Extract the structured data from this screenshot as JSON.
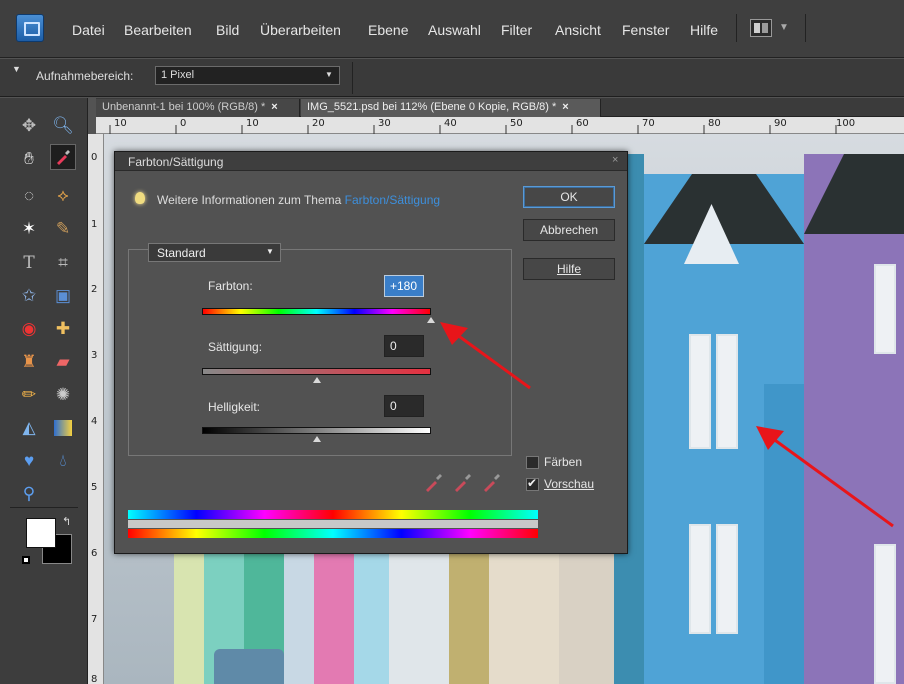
{
  "menu": {
    "items": [
      "Datei",
      "Bearbeiten",
      "Bild",
      "Überarbeiten",
      "Ebene",
      "Auswahl",
      "Filter",
      "Ansicht",
      "Fenster",
      "Hilfe"
    ]
  },
  "options": {
    "label": "Aufnahmebereich:",
    "sample_value": "1 Pixel"
  },
  "tabs": [
    {
      "label": "Unbenannt-1 bei 100% (RGB/8) *",
      "close": "×"
    },
    {
      "label": "IMG_5521.psd bei 112% (Ebene 0 Kopie, RGB/8) *",
      "close": "×"
    }
  ],
  "ruler": {
    "top": [
      "10",
      "0",
      "10",
      "20",
      "30",
      "40",
      "50",
      "60",
      "70",
      "80",
      "90",
      "100"
    ],
    "left": [
      "0",
      "1",
      "2",
      "3",
      "4",
      "5",
      "6",
      "7",
      "8"
    ]
  },
  "dialog": {
    "title": "Farbton/Sättigung",
    "close": "×",
    "info_prefix": "Weitere Informationen zum Thema",
    "info_link": "Farbton/Sättigung",
    "ok": "OK",
    "cancel": "Abbrechen",
    "help": "Hilfe",
    "channel": "Standard",
    "hue_label": "Farbton:",
    "hue_value": "+180",
    "saturation_label": "Sättigung:",
    "saturation_value": "0",
    "lightness_label": "Helligkeit:",
    "lightness_value": "0",
    "colorize_label": "Färben",
    "preview_label": "Vorschau"
  },
  "controls": {
    "hue": 180,
    "hue_min": -180,
    "hue_max": 180,
    "saturation": 0,
    "lightness": 0,
    "colorize_checked": false,
    "preview_checked": true
  },
  "colors": {
    "accent": "#3d8fdc",
    "arrow": "#e8151a",
    "dialog_bg": "#525252",
    "app_bg": "#3d3d3d"
  },
  "icons": {
    "tools": [
      "move-tool-icon",
      "zoom-tool-icon",
      "hand-tool-icon",
      "eyedropper-tool-icon",
      "lasso-tool-icon",
      "polygon-lasso-tool-icon",
      "magic-wand-tool-icon",
      "brush-selection-tool-icon",
      "text-tool-icon",
      "crop-tool-icon",
      "shape-tool-icon",
      "cookie-cutter-tool-icon",
      "red-eye-tool-icon",
      "healing-brush-tool-icon",
      "stamp-tool-icon",
      "eraser-tool-icon",
      "pencil-tool-icon",
      "smart-brush-tool-icon",
      "paint-bucket-tool-icon",
      "gradient-tool-icon",
      "custom-shape-tool-icon",
      "blur-tool-icon",
      "zoom-small-tool-icon"
    ]
  }
}
